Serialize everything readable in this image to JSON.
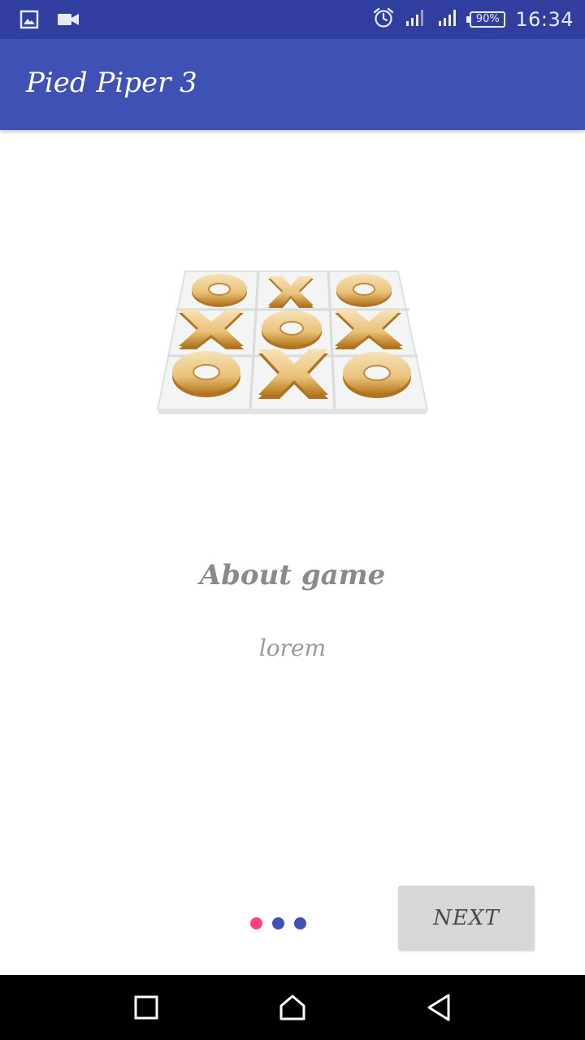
{
  "status_bar": {
    "left_icons": [
      "image-icon",
      "video-camera-icon"
    ],
    "right_icons": [
      "alarm-icon",
      "signal-icon",
      "signal-icon"
    ],
    "battery": "90%",
    "time": "16:34"
  },
  "app_bar": {
    "title": "Pied Piper 3"
  },
  "content": {
    "image": "tic-tac-toe-board",
    "heading": "About game",
    "body": "lorem"
  },
  "pager": {
    "dot_count": 3,
    "active_index": 0,
    "active_color": "#ff4081",
    "inactive_color": "#3f51b5"
  },
  "next_button": {
    "label": "NEXT"
  },
  "nav_bar": {
    "buttons": [
      "recent-apps-icon",
      "home-icon",
      "back-icon"
    ]
  },
  "colors": {
    "status_bar": "#303f9f",
    "app_bar": "#3f51b5",
    "button_bg": "#d6d7d7"
  }
}
